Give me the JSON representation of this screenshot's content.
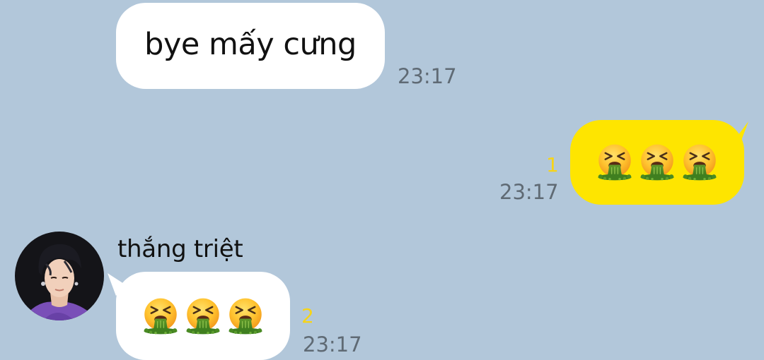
{
  "conversation": {
    "messages": [
      {
        "direction": "incoming",
        "text": "bye mấy cưng",
        "time": "23:17"
      },
      {
        "direction": "outgoing",
        "emoji": [
          "face-vomiting-icon",
          "face-vomiting-icon",
          "face-vomiting-icon"
        ],
        "unread_count": "1",
        "time": "23:17"
      },
      {
        "direction": "incoming",
        "sender": "thắng triệt",
        "emoji": [
          "face-vomiting-icon",
          "face-vomiting-icon",
          "face-vomiting-icon"
        ],
        "unread_count": "2",
        "time": "23:17"
      }
    ]
  },
  "colors": {
    "background": "#b2c7da",
    "incoming_bubble": "#ffffff",
    "outgoing_bubble": "#fee500",
    "time_text": "#5f6a74",
    "unread_count": "#f7d417"
  }
}
